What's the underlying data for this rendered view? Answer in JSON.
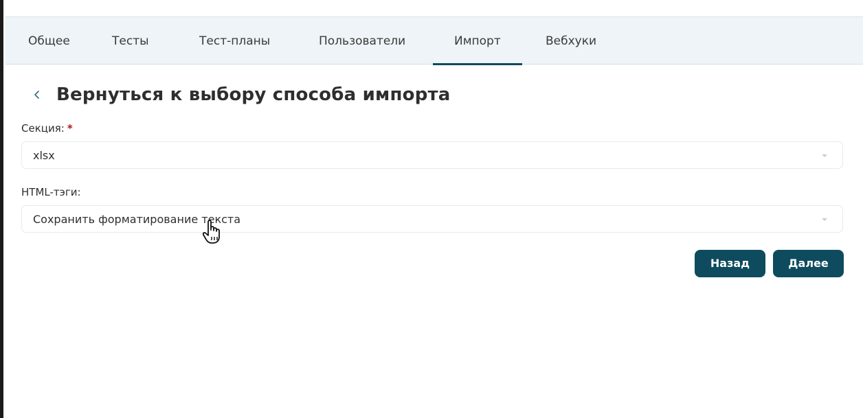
{
  "tabs": [
    {
      "label": "Общее",
      "active": false
    },
    {
      "label": "Тесты",
      "active": false
    },
    {
      "label": "Тест-планы",
      "active": false
    },
    {
      "label": "Пользователи",
      "active": false
    },
    {
      "label": "Импорт",
      "active": true
    },
    {
      "label": "Вебхуки",
      "active": false
    }
  ],
  "back": {
    "title": "Вернуться к выбору способа импорта",
    "icon": "chevron-left-icon"
  },
  "section": {
    "label": "Секция:",
    "required_mark": "*",
    "value": "xlsx"
  },
  "html_tags": {
    "label": "HTML-тэги:",
    "value": "Сохранить форматирование текста"
  },
  "buttons": {
    "back_label": "Назад",
    "next_label": "Далее"
  },
  "colors": {
    "accent": "#0f4b5e",
    "tabbar_bg": "#eef4f7",
    "required": "#b3121b"
  }
}
